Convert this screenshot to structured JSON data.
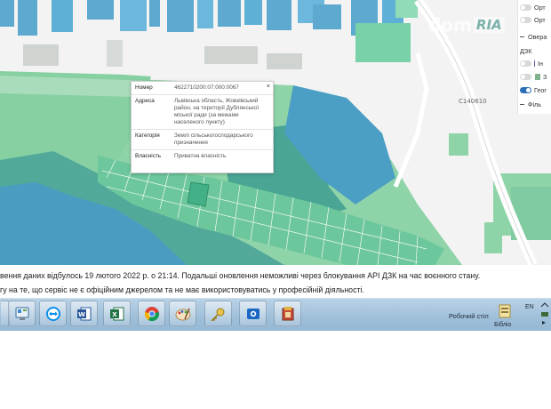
{
  "map": {
    "watermark_part1": "dom",
    "watermark_part2": "RIA",
    "road_label": "С140610"
  },
  "popup": {
    "close_symbol": "×",
    "rows": [
      {
        "label": "Номер",
        "value": "4622710200:07:000:0067"
      },
      {
        "label": "Адреса",
        "value": "Львівська область, Жовківський район, на території Дублянської міської ради (за межами населеного пункту)"
      },
      {
        "label": "Категорія",
        "value": "Землі сільськогосподарського призначення"
      },
      {
        "label": "Власність",
        "value": "Приватна власність"
      }
    ]
  },
  "layers": {
    "items": [
      {
        "label": "Орт",
        "state": "off"
      },
      {
        "label": "Орт",
        "state": "off"
      },
      {
        "label": "Овера",
        "state": "line"
      },
      {
        "label": "ДЗК",
        "state": "header"
      },
      {
        "label": "Ін",
        "state": "off-dash"
      },
      {
        "label": "З",
        "state": "off-swatch"
      },
      {
        "label": "Геог",
        "state": "on"
      },
      {
        "label": "Філь",
        "state": "line"
      }
    ],
    "swatch_color": "#7fb28c",
    "dash_color": "#5b5bb0"
  },
  "notice": {
    "line1": "вення даних відбулось 19 лютого 2022 р. о 21:14. Подальші оновлення неможливі через блокування API ДЗК на час воєнного стану.",
    "line2": "гу на те, що сервіс не є офіційним джерелом та не має використовуватись у професійній діяльності."
  },
  "taskbar": {
    "apps": [
      "control-panel-icon",
      "teamviewer-icon",
      "word-icon",
      "excel-icon",
      "chrome-icon",
      "paint-icon",
      "key-icon",
      "outlook-icon",
      "archive-icon"
    ],
    "desktop_label": "Робочий стіл",
    "libraries_label": "Бібліо",
    "language": "EN"
  }
}
